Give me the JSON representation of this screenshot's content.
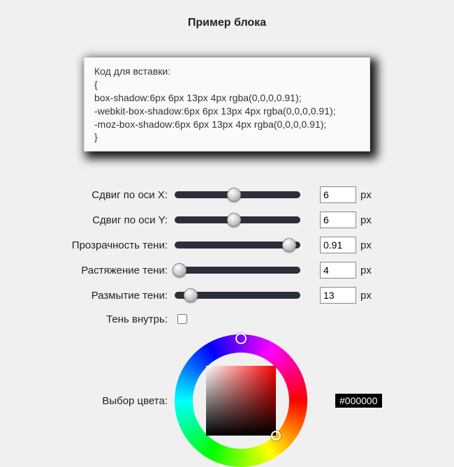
{
  "title": "Пример блока",
  "code": {
    "label": "Код для вставки:",
    "open": "{",
    "line1": "box-shadow:6px 6px 13px 4px rgba(0,0,0,0.91);",
    "line2": "-webkit-box-shadow:6px 6px 13px 4px rgba(0,0,0,0.91);",
    "line3": "-moz-box-shadow:6px 6px 13px 4px rgba(0,0,0,0.91);",
    "close": "}"
  },
  "sliders": {
    "shiftX": {
      "label": "Сдвиг по оси X:",
      "value": "6",
      "unit": "px",
      "pos": 47
    },
    "shiftY": {
      "label": "Сдвиг по оси Y:",
      "value": "6",
      "unit": "px",
      "pos": 47
    },
    "opacity": {
      "label": "Прозрачность тени:",
      "value": "0.91",
      "unit": "px",
      "pos": 91
    },
    "spread": {
      "label": "Растяжение тени:",
      "value": "4",
      "unit": "px",
      "pos": 4
    },
    "blur": {
      "label": "Размытие тени:",
      "value": "13",
      "unit": "px",
      "pos": 13
    }
  },
  "inset": {
    "label": "Тень внутрь:",
    "checked": false
  },
  "color": {
    "label": "Выбор цвета:",
    "value": "#000000"
  }
}
